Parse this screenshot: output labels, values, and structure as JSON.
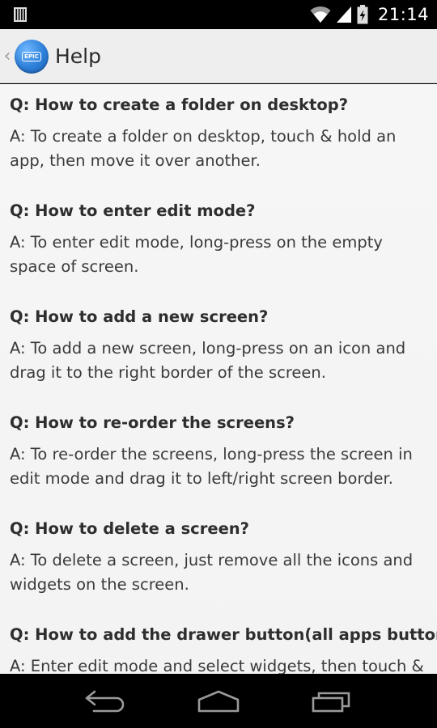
{
  "status_bar": {
    "time": "21:14",
    "icons": [
      "notification-icon",
      "wifi-icon",
      "signal-icon",
      "battery-icon"
    ]
  },
  "action_bar": {
    "title": "Help",
    "app_icon_text": "EPIC",
    "back_icon": "chevron-left-icon"
  },
  "faq": [
    {
      "q": "Q: How to create a folder on desktop?",
      "a": "A: To create a folder on desktop, touch & hold an app, then move it over another."
    },
    {
      "q": "Q: How to enter edit mode?",
      "a": "A: To enter edit mode, long-press on the empty space of screen."
    },
    {
      "q": "Q: How to add a new screen?",
      "a": "A: To add a new screen, long-press on an icon and drag it to the right border of the screen."
    },
    {
      "q": "Q: How to re-order the screens?",
      "a": "A: To re-order the screens, long-press the screen in edit mode and drag it to left/right screen border."
    },
    {
      "q": "Q: How to delete a screen?",
      "a": "A: To delete a screen, just remove all the icons and widgets on the screen."
    },
    {
      "q": "Q: How to add the drawer button(all apps button)?",
      "a": "A: Enter edit mode and select widgets, then touch & hold Epic Actions to your desktop and select app"
    }
  ],
  "nav_bar": {
    "icons": [
      "back-icon",
      "home-icon",
      "recent-apps-icon"
    ]
  },
  "colors": {
    "action_bar_bg": "#eeeeee",
    "content_bg": "#f5f5f5",
    "app_icon_blue": "#2c7fd8"
  }
}
